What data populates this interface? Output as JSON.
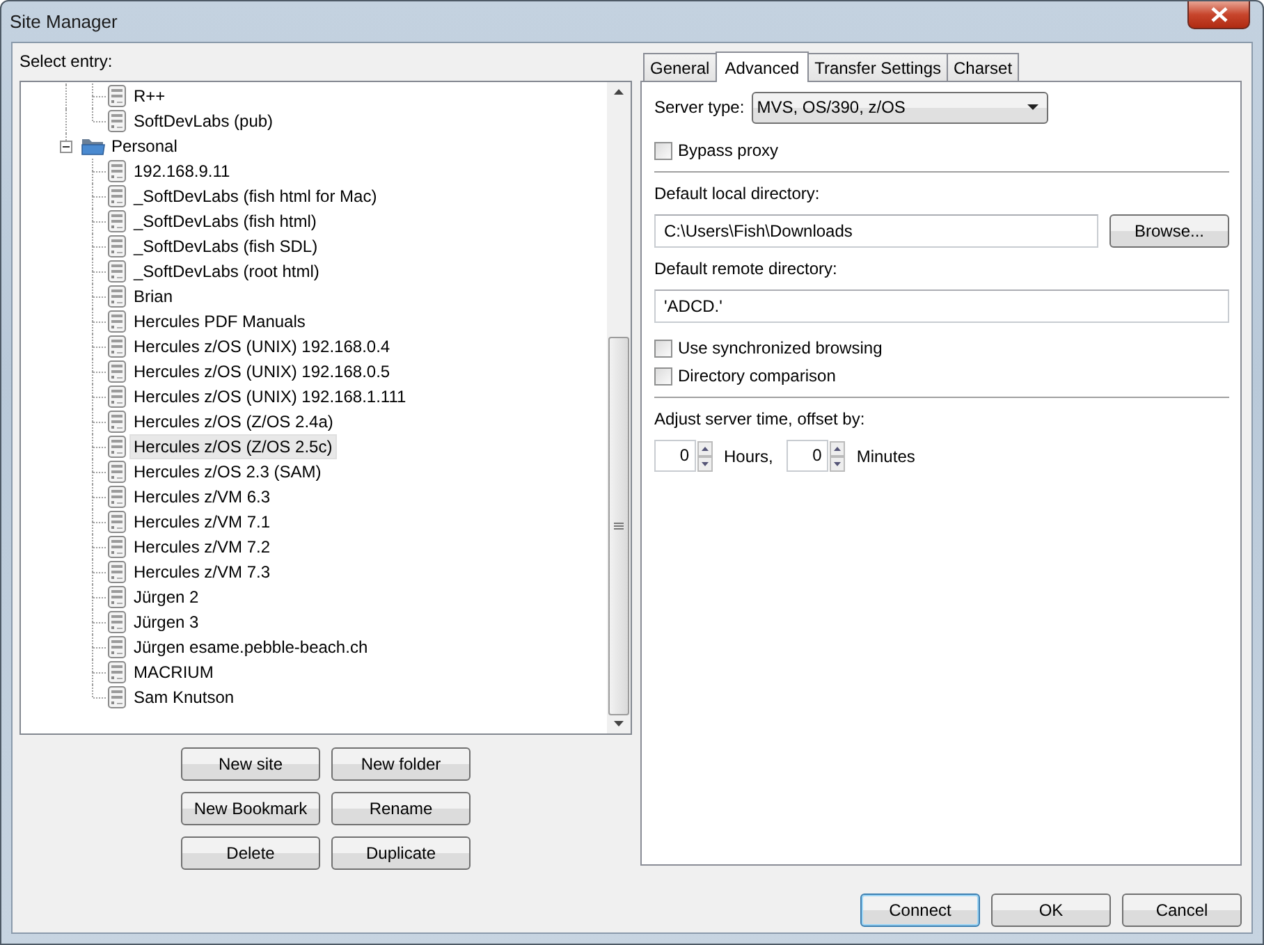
{
  "window": {
    "title": "Site Manager"
  },
  "select_entry_label": "Select entry:",
  "tree": [
    {
      "kind": "folder_continued",
      "children": [
        {
          "kind": "site",
          "label": "R++",
          "selected": false
        },
        {
          "kind": "site",
          "label": "SoftDevLabs (pub)",
          "selected": false
        }
      ]
    },
    {
      "kind": "folder",
      "label": "Personal",
      "expanded": true,
      "selected": false,
      "children": [
        {
          "kind": "site",
          "label": "192.168.9.11",
          "selected": false
        },
        {
          "kind": "site",
          "label": "_SoftDevLabs (fish html for Mac)",
          "selected": false
        },
        {
          "kind": "site",
          "label": "_SoftDevLabs (fish html)",
          "selected": false
        },
        {
          "kind": "site",
          "label": "_SoftDevLabs (fish SDL)",
          "selected": false
        },
        {
          "kind": "site",
          "label": "_SoftDevLabs (root html)",
          "selected": false
        },
        {
          "kind": "site",
          "label": "Brian",
          "selected": false
        },
        {
          "kind": "site",
          "label": "Hercules PDF Manuals",
          "selected": false
        },
        {
          "kind": "site",
          "label": "Hercules z/OS (UNIX) 192.168.0.4",
          "selected": false
        },
        {
          "kind": "site",
          "label": "Hercules z/OS (UNIX) 192.168.0.5",
          "selected": false
        },
        {
          "kind": "site",
          "label": "Hercules z/OS (UNIX) 192.168.1.111",
          "selected": false
        },
        {
          "kind": "site",
          "label": "Hercules z/OS (Z/OS 2.4a)",
          "selected": false
        },
        {
          "kind": "site",
          "label": "Hercules z/OS (Z/OS 2.5c)",
          "selected": true
        },
        {
          "kind": "site",
          "label": "Hercules z/OS 2.3 (SAM)",
          "selected": false
        },
        {
          "kind": "site",
          "label": "Hercules z/VM 6.3",
          "selected": false
        },
        {
          "kind": "site",
          "label": "Hercules z/VM 7.1",
          "selected": false
        },
        {
          "kind": "site",
          "label": "Hercules z/VM 7.2",
          "selected": false
        },
        {
          "kind": "site",
          "label": "Hercules z/VM 7.3",
          "selected": false
        },
        {
          "kind": "site",
          "label": "Jürgen 2",
          "selected": false
        },
        {
          "kind": "site",
          "label": "Jürgen 3",
          "selected": false
        },
        {
          "kind": "site",
          "label": "Jürgen esame.pebble-beach.ch",
          "selected": false
        },
        {
          "kind": "site",
          "label": "MACRIUM",
          "selected": false
        },
        {
          "kind": "site",
          "label": "Sam Knutson",
          "selected": false
        }
      ]
    }
  ],
  "left_buttons": [
    "New site",
    "New folder",
    "New Bookmark",
    "Rename",
    "Delete",
    "Duplicate"
  ],
  "tabs": [
    {
      "label": "General",
      "selected": false
    },
    {
      "label": "Advanced",
      "selected": true
    },
    {
      "label": "Transfer Settings",
      "selected": false
    },
    {
      "label": "Charset",
      "selected": false
    }
  ],
  "advanced": {
    "server_type": {
      "label": "Server type:",
      "value": "MVS, OS/390, z/OS"
    },
    "bypass_proxy": {
      "label": "Bypass proxy",
      "checked": false
    },
    "local_dir": {
      "label": "Default local directory:",
      "value": "C:\\Users\\Fish\\Downloads",
      "button": "Browse..."
    },
    "remote_dir": {
      "label": "Default remote directory:",
      "value": "'ADCD.'"
    },
    "sync_browsing": {
      "label": "Use synchronized browsing",
      "checked": false
    },
    "dir_comparison": {
      "label": "Directory comparison",
      "checked": false
    },
    "time_offset": {
      "label": "Adjust server time, offset by:",
      "hours": "0",
      "hours_label": "Hours,",
      "minutes": "0",
      "minutes_label": "Minutes"
    }
  },
  "dialog_buttons": [
    {
      "label": "Connect",
      "default": true
    },
    {
      "label": "OK",
      "default": false
    },
    {
      "label": "Cancel",
      "default": false
    }
  ]
}
